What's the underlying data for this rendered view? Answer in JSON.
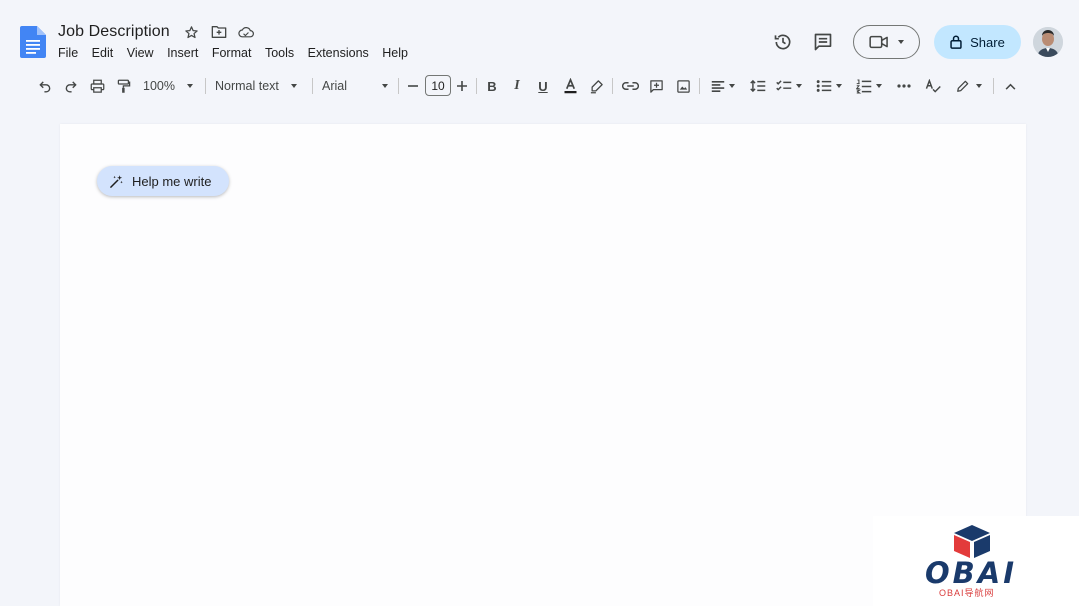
{
  "document": {
    "title": "Job Description"
  },
  "menu": [
    "File",
    "Edit",
    "View",
    "Insert",
    "Format",
    "Tools",
    "Extensions",
    "Help"
  ],
  "header": {
    "share_label": "Share"
  },
  "toolbar": {
    "zoom": "100%",
    "style": "Normal text",
    "font": "Arial",
    "font_size": "10"
  },
  "page": {
    "help_me_write": "Help me write"
  },
  "watermark": {
    "brand": "OBAI",
    "sub": "OBAI导航网"
  },
  "colors": {
    "share_bg": "#c2e7ff",
    "chip_bg": "#d3e3fd",
    "docs_blue": "#4285f4"
  }
}
